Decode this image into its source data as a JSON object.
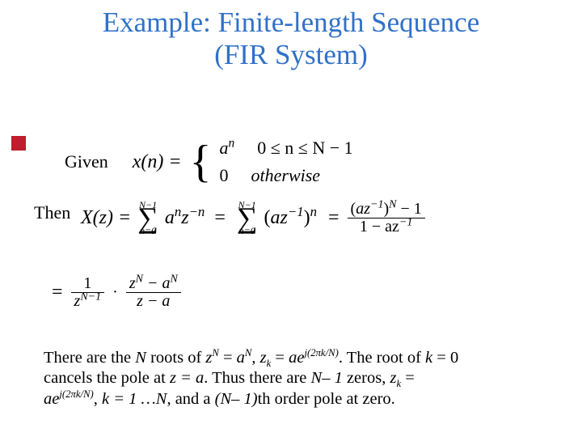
{
  "title_line1": "Example: Finite-length Sequence",
  "title_line2": "(FIR System)",
  "labels": {
    "given": "Given",
    "then": "Then"
  },
  "given": {
    "lhs": "x(n) =",
    "case1_expr": "a",
    "case1_sup": "n",
    "case1_cond": "0 ≤ n ≤ N − 1",
    "case2_expr": "0",
    "case2_cond": "otherwise"
  },
  "eq1": {
    "Xz": "X(z) =",
    "sum_upper": "N−1",
    "sum_lower": "n=0",
    "term1_a": "a",
    "term1_an": "n",
    "term1_z": "z",
    "term1_zn": "−n",
    "eq": "=",
    "term2_open": "(",
    "term2_az": "az",
    "term2_exp": "−1",
    "term2_close": ")",
    "term2_outexp": "n",
    "rhs_num_open": "(",
    "rhs_num_az": "az",
    "rhs_num_exp": "−1",
    "rhs_num_close": ")",
    "rhs_num_outexp": "N",
    "rhs_num_tail": "− 1",
    "rhs_den": "1 − az",
    "rhs_den_exp": "−1",
    "rhs_eq": "= "
  },
  "eq2": {
    "eq": "=",
    "f1_num": "1",
    "f1_den_z": "z",
    "f1_den_exp": "N−1",
    "dot": "·",
    "f2_num_z": "z",
    "f2_num_exp": "N",
    "f2_num_tail": " − a",
    "f2_num_aexp": "N",
    "f2_den": "z − a"
  },
  "para": {
    "p1a": "There are the ",
    "N": "N",
    "p1b": " roots of ",
    "zN1": "z",
    "zN1sup": "N",
    "p1c": " = ",
    "aN": "a",
    "aNsup": "N",
    "p1d": ", ",
    "zk": "z",
    "zk_sub": "k",
    "p1e": " = ",
    "ae": "ae",
    "ae_sup": "j(2πk/N)",
    "p1f": ". The root of ",
    "k0": "k",
    "eq0": " = 0",
    "p2a": "cancels the pole at ",
    "za": "z = a",
    "p2b": ". Thus there are ",
    "Nm1": "N– 1",
    "p2c": " zeros, ",
    "zk2": "z",
    "zk2_sub": "k",
    "p2d": " = ",
    "ae2": "ae",
    "ae2_sup": "j(2πk/N)",
    "p3a": ", ",
    "k1N": "k = 1 …N",
    "p3b": ", and a ",
    "paren": "(N– 1)",
    "p3c": "th order pole at zero."
  }
}
